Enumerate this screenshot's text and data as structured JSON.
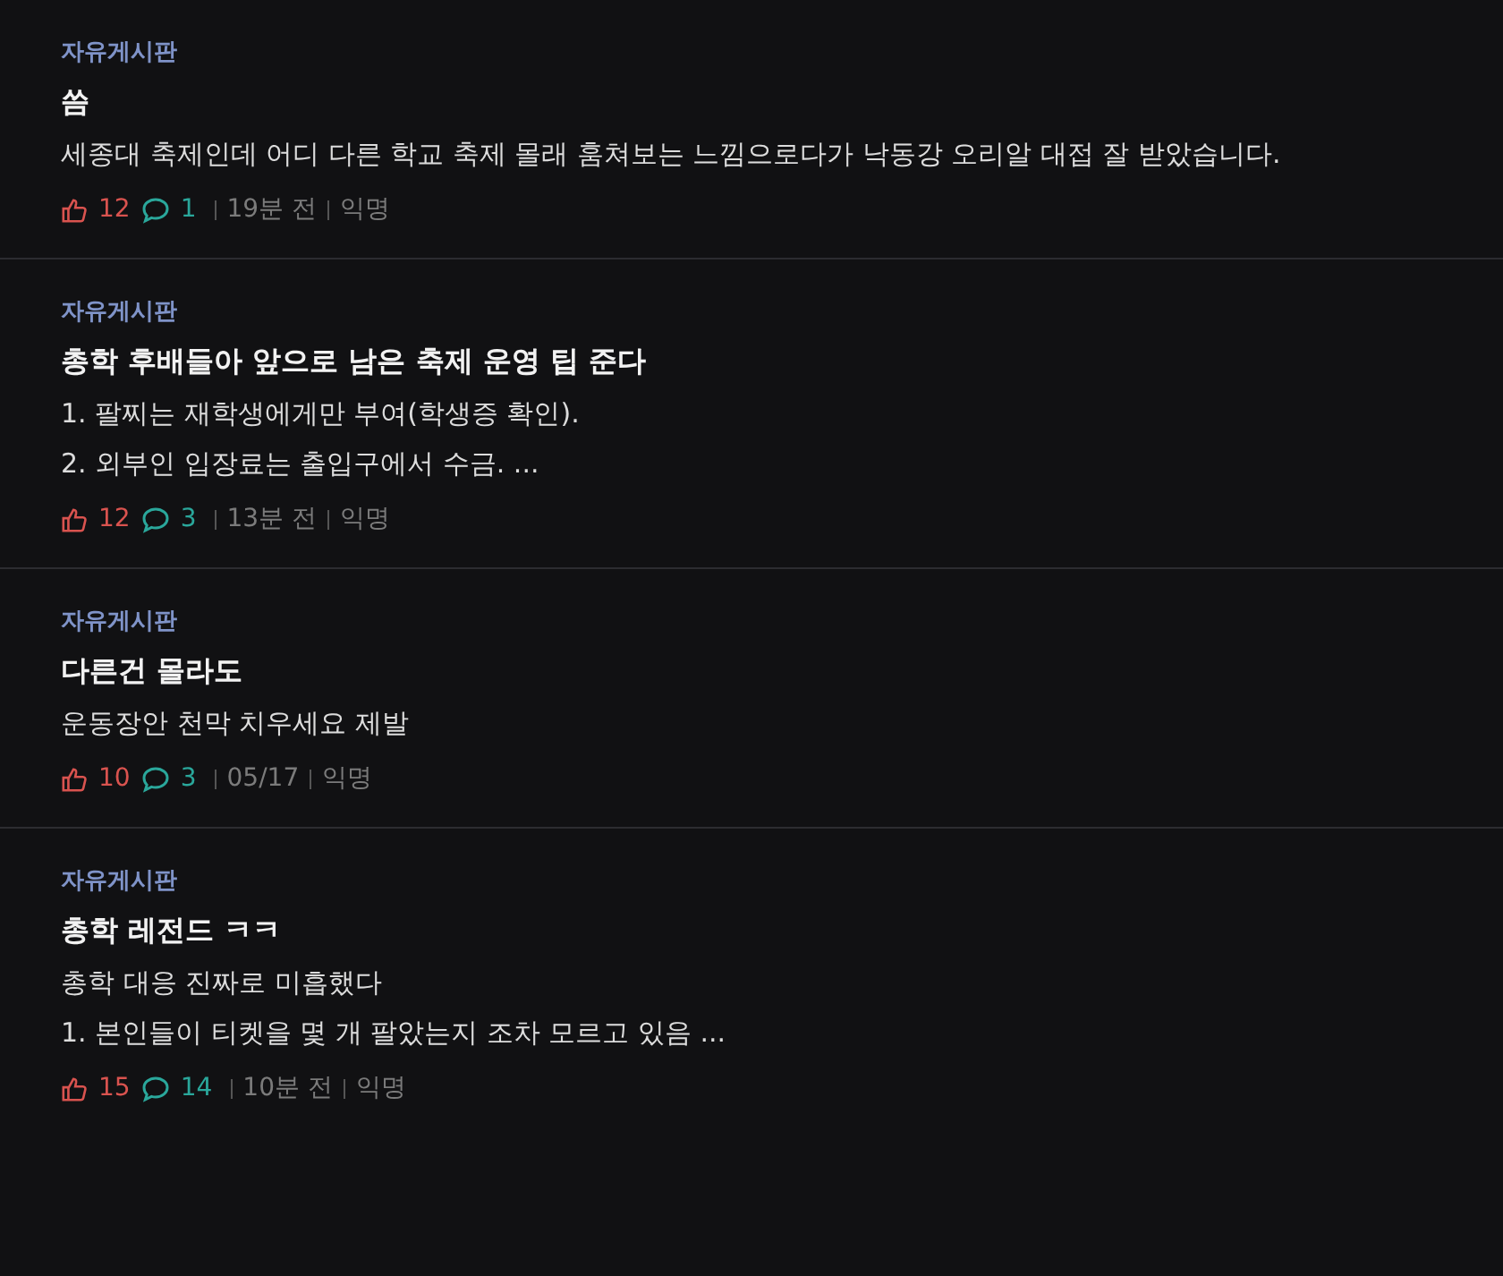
{
  "posts": [
    {
      "board": "자유게시판",
      "title": "씀",
      "body": [
        "세종대 축제인데 어디 다른 학교 축제 몰래 훔쳐보는 느낌으로다가 낙동강 오리알 대접 잘 받았습니다."
      ],
      "likes": "12",
      "comments": "1",
      "time": "19분 전",
      "author": "익명"
    },
    {
      "board": "자유게시판",
      "title": "총학 후배들아 앞으로 남은 축제 운영 팁 준다",
      "body": [
        "1. 팔찌는 재학생에게만 부여(학생증 확인).",
        "2. 외부인 입장료는 출입구에서 수금. ..."
      ],
      "likes": "12",
      "comments": "3",
      "time": "13분 전",
      "author": "익명"
    },
    {
      "board": "자유게시판",
      "title": "다른건 몰라도",
      "body": [
        "운동장안 천막 치우세요 제발"
      ],
      "likes": "10",
      "comments": "3",
      "time": "05/17",
      "author": "익명"
    },
    {
      "board": "자유게시판",
      "title": "총학 레전드 ㅋㅋ",
      "body": [
        "총학 대응 진짜로 미흡했다",
        "1. 본인들이 티켓을 몇 개 팔았는지 조차 모르고 있음 ..."
      ],
      "likes": "15",
      "comments": "14",
      "time": "10분 전",
      "author": "익명"
    }
  ]
}
